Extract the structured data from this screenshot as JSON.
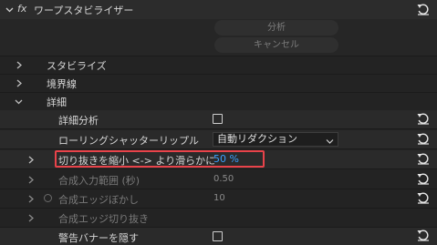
{
  "effect": {
    "title": "ワープスタビライザー",
    "fx_label": "fx"
  },
  "buttons": {
    "analyze": "分析",
    "cancel": "キャンセル"
  },
  "sections": {
    "stabilize": "スタビライズ",
    "borders": "境界線",
    "advanced": "詳細"
  },
  "advanced": {
    "detailed_analysis": "詳細分析",
    "rolling_shutter": "ローリングシャッターリップル",
    "rolling_shutter_value": "自動リダクション",
    "crop_less_smooth_more": "切り抜きを縮小 <-> より滑らかに",
    "crop_value": "50 %",
    "synthesis_input_range": "合成入力範囲 (秒)",
    "synthesis_input_range_value": "0.50",
    "synthesis_edge_feather": "合成エッジぼかし",
    "synthesis_edge_feather_value": "10",
    "synthesis_edge_cropping": "合成エッジ切り抜き",
    "hide_warning_banner": "警告バナーを隠す"
  },
  "icons": {
    "reset": "reset-arrow-icon",
    "chevron_right": "chevron-right-icon",
    "chevron_down": "chevron-down-icon"
  },
  "colors": {
    "highlight": "#e8434a",
    "value_blue": "#3aa0ff"
  }
}
